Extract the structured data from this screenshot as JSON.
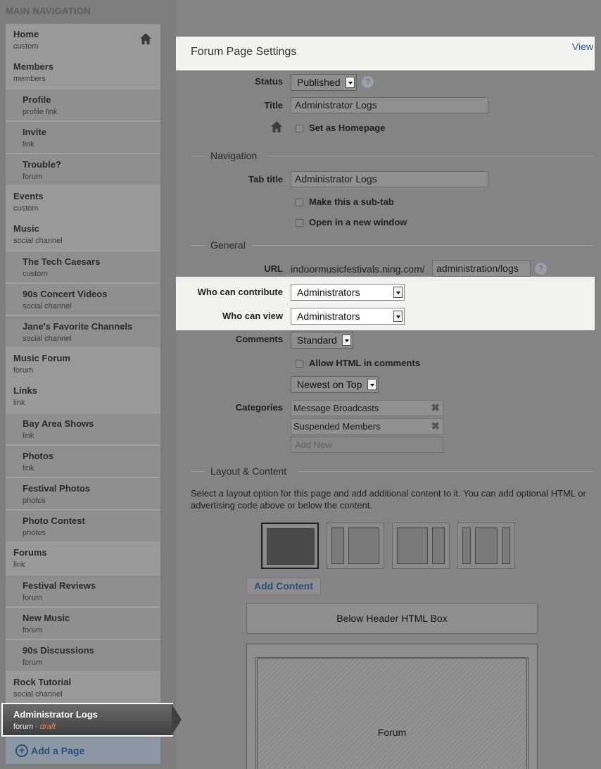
{
  "sidebar": {
    "header": "MAIN NAVIGATION",
    "items": [
      {
        "label": "Home",
        "type": "custom"
      },
      {
        "label": "Members",
        "type": "members"
      },
      {
        "label": "Profile",
        "type": "profile link"
      },
      {
        "label": "Invite",
        "type": "link"
      },
      {
        "label": "Trouble?",
        "type": "forum"
      },
      {
        "label": "Events",
        "type": "custom"
      },
      {
        "label": "Music",
        "type": "social channel"
      },
      {
        "label": "The Tech Caesars",
        "type": "custom"
      },
      {
        "label": "90s Concert Videos",
        "type": "social channel"
      },
      {
        "label": "Jane's Favorite Channels",
        "type": "social channel"
      },
      {
        "label": "Music Forum",
        "type": "forum"
      },
      {
        "label": "Links",
        "type": "link"
      },
      {
        "label": "Bay Area Shows",
        "type": "link"
      },
      {
        "label": "Photos",
        "type": "link"
      },
      {
        "label": "Festival Photos",
        "type": "photos"
      },
      {
        "label": "Photo Contest",
        "type": "photos"
      },
      {
        "label": "Forums",
        "type": "link"
      },
      {
        "label": "Festival Reviews",
        "type": "forum"
      },
      {
        "label": "New Music",
        "type": "forum"
      },
      {
        "label": "90s Discussions",
        "type": "forum"
      },
      {
        "label": "Rock Tutorial",
        "type": "social channel"
      }
    ],
    "selected": {
      "label": "Administrator Logs",
      "type": "forum",
      "separator": "·",
      "status": "draft"
    },
    "add_page_label": "Add a Page"
  },
  "settings": {
    "title": "Forum Page Settings",
    "view_link": "View",
    "status_label": "Status",
    "status_value": "Published",
    "title_label": "Title",
    "title_value": "Administrator Logs",
    "homepage_label": "Set as Homepage"
  },
  "navigation": {
    "section": "Navigation",
    "tab_title_label": "Tab title",
    "tab_title_value": "Administrator Logs",
    "subtab_label": "Make this a sub-tab",
    "new_window_label": "Open in a new window"
  },
  "general": {
    "section": "General",
    "url_label": "URL",
    "url_prefix": "indoormusicfestivals.ning.com/",
    "url_value": "administration/logs",
    "contribute_label": "Who can contribute",
    "contribute_value": "Administrators",
    "view_label": "Who can view",
    "view_value": "Administrators",
    "comments_label": "Comments",
    "comments_value": "Standard",
    "allow_html_label": "Allow HTML in comments",
    "sort_value": "Newest on Top",
    "categories_label": "Categories",
    "categories": [
      "Message Broadcasts",
      "Suspended Members"
    ],
    "add_new_placeholder": "Add New"
  },
  "layout": {
    "section": "Layout & Content",
    "description": "Select a layout option for this page and add additional content to it. You can add optional HTML or advertising code above or below the content.",
    "add_content_label": "Add Content",
    "below_header_box": "Below Header HTML Box",
    "content_box": "Forum"
  }
}
